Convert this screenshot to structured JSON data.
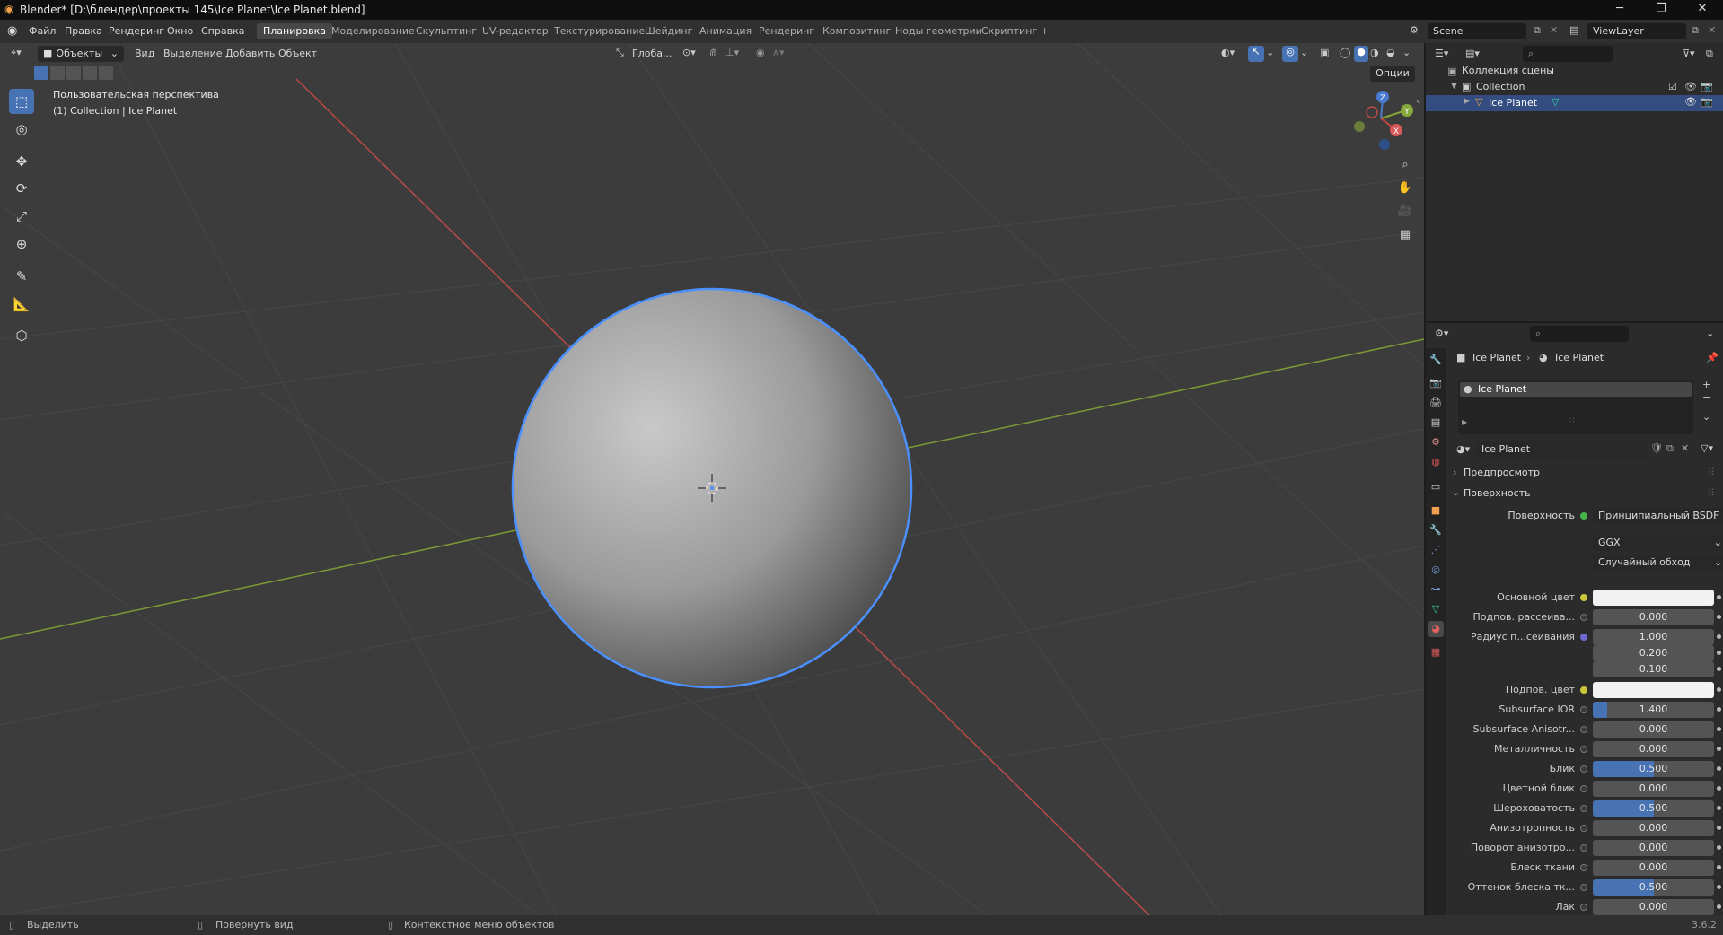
{
  "window": {
    "title": "Blender* [D:\\блендер\\проекты 145\\Ice Planet\\Ice Planet.blend]"
  },
  "menu": [
    "Файл",
    "Правка",
    "Рендеринг",
    "Окно",
    "Справка"
  ],
  "workspaces": [
    "Планировка",
    "Моделирование",
    "Скульптинг",
    "UV-редактор",
    "Текстурирование",
    "Шейдинг",
    "Анимация",
    "Рендеринг",
    "Композитинг",
    "Ноды геометрии",
    "Скриптинг"
  ],
  "workspace_add": "+",
  "scene": {
    "name": "Scene",
    "view_layer": "ViewLayer"
  },
  "viewport": {
    "mode": "Объекты",
    "menu": [
      "Вид",
      "Выделение",
      "Добавить",
      "Объект"
    ],
    "transform_orientation": "Глоба...",
    "options": "Опции",
    "overlay_title": "Пользовательская перспектива",
    "overlay_subtitle": "(1) Collection | Ice Planet",
    "gizmo": {
      "x": "X",
      "y": "Y",
      "z": "Z"
    }
  },
  "outliner": {
    "root": "Коллекция сцены",
    "collection": "Collection",
    "object": "Ice Planet"
  },
  "properties": {
    "breadcrumb_object": "Ice Planet",
    "breadcrumb_material": "Ice Planet",
    "material_slot": "Ice Planet",
    "material_name": "Ice Planet",
    "panel_preview": "Предпросмотр",
    "panel_surface": "Поверхность",
    "surface_label": "Поверхность",
    "surface_value": "Принципиальный BSDF",
    "distribution": "GGX",
    "subsurface_method": "Случайный обход",
    "rows": [
      {
        "label": "Основной цвет",
        "type": "color",
        "color": "#f2f2f2",
        "dot": "#c8c83a"
      },
      {
        "label": "Подпов. рассеива...",
        "value": "0.000",
        "fill": 0
      },
      {
        "label": "Радиус п...сеивания",
        "value": "1.000",
        "fill": 0,
        "dot": "#6a6ad0"
      },
      {
        "label": "",
        "value": "0.200",
        "fill": 0,
        "nodot": true
      },
      {
        "label": "",
        "value": "0.100",
        "fill": 0,
        "nodot": true
      },
      {
        "label": "Подпов. цвет",
        "type": "color",
        "color": "#f2f2f2",
        "dot": "#c8c83a"
      },
      {
        "label": "Subsurface IOR",
        "value": "1.400",
        "fill": 0.12
      },
      {
        "label": "Subsurface Anisotr...",
        "value": "0.000",
        "fill": 0
      },
      {
        "label": "Металличность",
        "value": "0.000",
        "fill": 0
      },
      {
        "label": "Блик",
        "value": "0.500",
        "fill": 0.5
      },
      {
        "label": "Цветной блик",
        "value": "0.000",
        "fill": 0
      },
      {
        "label": "Шероховатость",
        "value": "0.500",
        "fill": 0.5
      },
      {
        "label": "Анизотропность",
        "value": "0.000",
        "fill": 0
      },
      {
        "label": "Поворот анизотро...",
        "value": "0.000",
        "fill": 0
      },
      {
        "label": "Блеск ткани",
        "value": "0.000",
        "fill": 0
      },
      {
        "label": "Оттенок блеска тк...",
        "value": "0.500",
        "fill": 0.5
      },
      {
        "label": "Лак",
        "value": "0.000",
        "fill": 0
      }
    ]
  },
  "status": {
    "select": "Выделить",
    "rotate": "Повернуть вид",
    "context": "Контекстное меню объектов",
    "version": "3.6.2"
  },
  "colors": {
    "accent": "#4772b3",
    "selection_outline": "#4a90ff",
    "x_axis": "#c84646",
    "y_axis": "#86a83a"
  }
}
